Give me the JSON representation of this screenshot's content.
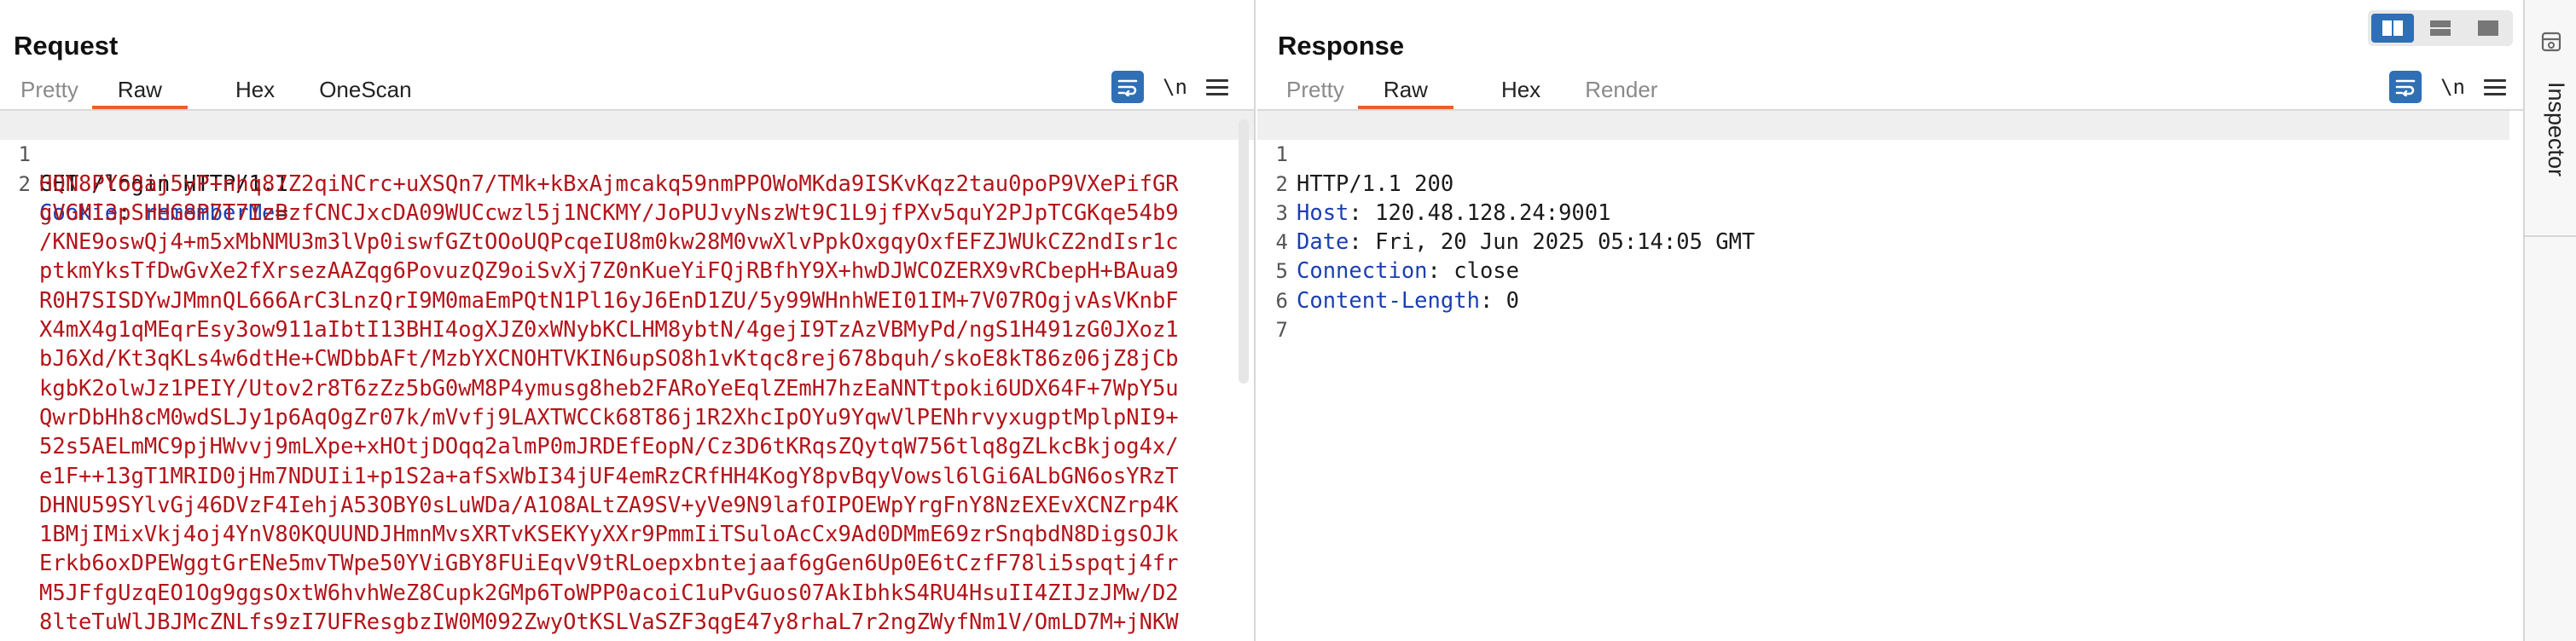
{
  "request": {
    "title": "Request",
    "tabs": [
      {
        "label": "Pretty",
        "muted": true
      },
      {
        "label": "Raw",
        "active": true
      },
      {
        "label": "Hex"
      },
      {
        "label": "OneScan"
      }
    ],
    "newline_label": "\\n",
    "line_numbers": [
      "1",
      "2"
    ],
    "request_line": "GET /login HTTP/1.1",
    "cookie_header": "Cookie",
    "cookie_name": "rememberMe",
    "cookie_eq": "=",
    "cookie_value_lines": [
      "HQN8PY68aj5yP+nhq87Z2qiNCrc+uXSQn7/TMk+kBxAjmcakq59nmPPOWoMKda9ISKvKqz2tau0poP9VXePifGR",
      "gVGMI3pSHHG8P7T7IzBzfCNCJxcDA09WUCcwzl5j1NCKMY/JoPUJvyNszWt9C1L9jfPXv5quY2PJpTCGKqe54b9",
      "/KNE9oswQj4+m5xMbNMU3m3lVp0iswfGZtOOoUQPcqeIU8m0kw28M0vwXlvPpkOxgqyOxfEFZJWUkCZ2ndIsr1c",
      "ptkmYksTfDwGvXe2fXrsezAAZqg6PovuzQZ9oiSvXj7Z0nKueYiFQjRBfhY9X+hwDJWCOZERX9vRCbepH+BAua9",
      "R0H7SISDYwJMmnQL666ArC3LnzQrI9M0maEmPQtN1Pl16yJ6EnD1ZU/5y99WHnhWEI01IM+7V07ROgjvAsVKnbF",
      "X4mX4g1qMEqrEsy3ow911aIbtI13BHI4ogXJZ0xWNybKCLHM8ybtN/4gejI9TzAzVBMyPd/ngS1H491zG0JXoz1",
      "bJ6Xd/Kt3qKLs4w6dtHe+CWDbbAFt/MzbYXCNOHTVKIN6upSO8h1vKtqc8rej678bquh/skoE8kT86z06jZ8jCb",
      "kgbK2olwJz1PEIY/Utov2r8T6zZz5bG0wM8P4ymusg8heb2FARoYeEqlZEmH7hzEaNNTtpoki6UDX64F+7WpY5u",
      "QwrDbHh8cM0wdSLJy1p6AqOgZr07k/mVvfj9LAXTWCCk68T86j1R2XhcIpOYu9YqwVlPENhrvyxugptMplpNI9+",
      "52s5AELmMC9pjHWvvj9mLXpe+xHOtjDOqq2almP0mJRDEfEopN/Cz3D6tKRqsZQytqW756tlq8gZLkcBkjog4x/",
      "e1F++13gT1MRID0jHm7NDUIi1+p1S2a+afSxWbI34jUF4emRzCRfHH4KogY8pvBqyVowsl6lGi6ALbGN6osYRzT",
      "DHNU59SYlvGj46DVzF4IehjA53OBY0sLuWDa/A1O8ALtZA9SV+yVe9N9lafOIPOEWpYrgFnY8NzEXEvXCNZrp4K",
      "1BMjIMixVkj4oj4YnV80KQUUNDJHmnMvsXRTvKSEKYyXXr9PmmIiTSuloAcCx9Ad0DMmE69zrSnqbdN8DigsOJk",
      "Erkb6oxDPEWggtGrENe5mvTWpe50YViGBY8FUiEqvV9tRLoepxbntejaaf6gGen6Up0E6tCzfF78li5spqtj4fr",
      "M5JFfgUzqEO1Og9ggsOxtW6hvhWeZ8Cupk2GMp6ToWPP0acoiC1uPvGuos07AkIbhkS4RU4HsuII4ZIJzJMw/D2",
      "8lteTuWlJBJMcZNLfs9zI7UFResgbzIW0M092ZwyOtKSLVaSZF3qgE47y8rhaL7r2ngZWyfNm1V/OmLD7M+jNKW"
    ]
  },
  "response": {
    "title": "Response",
    "tabs": [
      {
        "label": "Pretty",
        "muted": true
      },
      {
        "label": "Raw",
        "active": true
      },
      {
        "label": "Hex"
      },
      {
        "label": "Render",
        "muted": true
      }
    ],
    "newline_label": "\\n",
    "lines": [
      {
        "num": "1",
        "text": "HTTP/1.1 200"
      },
      {
        "num": "2",
        "name": "Host",
        "value": " 120.48.128.24:9001"
      },
      {
        "num": "3",
        "name": "Date",
        "value": " Fri, 20 Jun 2025 05:14:05 GMT"
      },
      {
        "num": "4",
        "name": "Connection",
        "value": " close"
      },
      {
        "num": "5",
        "name": "Content-Length",
        "value": " 0"
      },
      {
        "num": "6",
        "text": ""
      },
      {
        "num": "7",
        "text": ""
      }
    ]
  },
  "inspector": {
    "label": "Inspector"
  },
  "colors": {
    "accent_tab": "#e8602c",
    "button_blue": "#2f6fb6",
    "header_name": "#1b3fb0",
    "cookie_value": "#b3141a"
  }
}
